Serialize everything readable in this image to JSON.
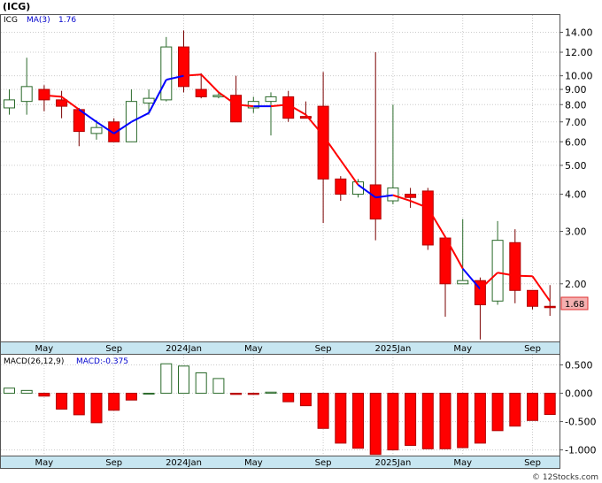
{
  "title": "(ICG)",
  "watermark": "© 12Stocks.com",
  "chart_data": [
    {
      "type": "candlestick",
      "ticker": "ICG",
      "ma_label": "MA(3)",
      "ma_value_text": "1.76",
      "last_price_text": "1.68",
      "y_scale": "log",
      "ylim": [
        1.28,
        16.0
      ],
      "y_ticks": [
        {
          "v": 14.0,
          "label": "14.00"
        },
        {
          "v": 12.0,
          "label": "12.00"
        },
        {
          "v": 10.0,
          "label": "10.00"
        },
        {
          "v": 9.0,
          "label": "9.00"
        },
        {
          "v": 8.0,
          "label": "8.00"
        },
        {
          "v": 7.0,
          "label": "7.00"
        },
        {
          "v": 6.0,
          "label": "6.00"
        },
        {
          "v": 5.0,
          "label": "5.00"
        },
        {
          "v": 4.0,
          "label": "4.00"
        },
        {
          "v": 3.0,
          "label": "3.00"
        },
        {
          "v": 2.0,
          "label": "2.00"
        }
      ],
      "x_ticks": [
        {
          "i": 2,
          "label": "May"
        },
        {
          "i": 6,
          "label": "Sep"
        },
        {
          "i": 10,
          "label": "2024Jan"
        },
        {
          "i": 14,
          "label": "May"
        },
        {
          "i": 18,
          "label": "Sep"
        },
        {
          "i": 22,
          "label": "2025Jan"
        },
        {
          "i": 26,
          "label": "May"
        },
        {
          "i": 30,
          "label": "Sep"
        }
      ],
      "candles": [
        {
          "o": 7.8,
          "h": 9.0,
          "l": 7.4,
          "c": 8.3
        },
        {
          "o": 8.2,
          "h": 11.5,
          "l": 7.4,
          "c": 9.2
        },
        {
          "o": 9.0,
          "h": 9.3,
          "l": 7.6,
          "c": 8.3
        },
        {
          "o": 8.3,
          "h": 8.9,
          "l": 7.2,
          "c": 7.9
        },
        {
          "o": 7.7,
          "h": 7.8,
          "l": 5.8,
          "c": 6.5
        },
        {
          "o": 6.4,
          "h": 7.1,
          "l": 6.1,
          "c": 6.7
        },
        {
          "o": 7.0,
          "h": 7.2,
          "l": 6.0,
          "c": 6.0
        },
        {
          "o": 6.0,
          "h": 9.0,
          "l": 6.0,
          "c": 8.2
        },
        {
          "o": 8.1,
          "h": 9.0,
          "l": 7.4,
          "c": 8.4
        },
        {
          "o": 8.3,
          "h": 13.5,
          "l": 8.2,
          "c": 12.5
        },
        {
          "o": 12.5,
          "h": 14.2,
          "l": 8.8,
          "c": 9.2
        },
        {
          "o": 9.0,
          "h": 10.2,
          "l": 8.4,
          "c": 8.5
        },
        {
          "o": 8.5,
          "h": 8.8,
          "l": 8.4,
          "c": 8.6
        },
        {
          "o": 8.6,
          "h": 10.0,
          "l": 7.0,
          "c": 7.0
        },
        {
          "o": 7.8,
          "h": 8.5,
          "l": 7.5,
          "c": 8.2
        },
        {
          "o": 8.2,
          "h": 8.8,
          "l": 6.3,
          "c": 8.5
        },
        {
          "o": 8.5,
          "h": 8.9,
          "l": 7.0,
          "c": 7.2
        },
        {
          "o": 7.3,
          "h": 8.2,
          "l": 7.2,
          "c": 7.2
        },
        {
          "o": 7.9,
          "h": 10.3,
          "l": 3.2,
          "c": 4.5
        },
        {
          "o": 4.5,
          "h": 4.6,
          "l": 3.8,
          "c": 4.0
        },
        {
          "o": 4.0,
          "h": 4.5,
          "l": 3.9,
          "c": 4.4
        },
        {
          "o": 4.3,
          "h": 12.0,
          "l": 2.8,
          "c": 3.3
        },
        {
          "o": 3.8,
          "h": 8.0,
          "l": 3.7,
          "c": 4.2
        },
        {
          "o": 4.0,
          "h": 4.2,
          "l": 3.6,
          "c": 3.9
        },
        {
          "o": 4.1,
          "h": 4.2,
          "l": 2.6,
          "c": 2.7
        },
        {
          "o": 2.85,
          "h": 2.9,
          "l": 1.55,
          "c": 2.0
        },
        {
          "o": 2.0,
          "h": 3.3,
          "l": 2.0,
          "c": 2.05
        },
        {
          "o": 2.05,
          "h": 2.1,
          "l": 1.3,
          "c": 1.7
        },
        {
          "o": 1.75,
          "h": 3.25,
          "l": 1.7,
          "c": 2.8
        },
        {
          "o": 2.75,
          "h": 3.05,
          "l": 1.72,
          "c": 1.9
        },
        {
          "o": 1.9,
          "h": 1.9,
          "l": 1.64,
          "c": 1.68
        },
        {
          "o": 1.68,
          "h": 1.98,
          "l": 1.56,
          "c": 1.67
        }
      ],
      "ma3": [
        null,
        null,
        8.6,
        8.5,
        7.7,
        7.0,
        6.4,
        7.0,
        7.5,
        9.7,
        10.0,
        10.1,
        8.8,
        8.0,
        7.9,
        7.9,
        8.0,
        7.4,
        6.3,
        5.2,
        4.3,
        3.9,
        3.97,
        3.8,
        3.6,
        2.87,
        2.25,
        1.92,
        2.18,
        2.13,
        2.12,
        1.75
      ],
      "ma3_up": [
        false,
        false,
        false,
        false,
        false,
        true,
        true,
        true,
        true,
        true,
        true,
        false,
        false,
        false,
        false,
        true,
        false,
        false,
        false,
        false,
        false,
        true,
        true,
        false,
        false,
        false,
        false,
        true,
        false,
        false,
        false,
        false
      ]
    },
    {
      "type": "bar",
      "label": "MACD(26,12,9)",
      "value_label": "MACD:-0.375",
      "ylim": [
        -1.1,
        0.68
      ],
      "y_ticks": [
        {
          "v": 0.5,
          "label": "0.500"
        },
        {
          "v": 0.0,
          "label": "0.000"
        },
        {
          "v": -0.5,
          "label": "-0.500"
        },
        {
          "v": -1.0,
          "label": "-1.000"
        }
      ],
      "x_ticks": [
        {
          "i": 2,
          "label": "May"
        },
        {
          "i": 6,
          "label": "Sep"
        },
        {
          "i": 10,
          "label": "2024Jan"
        },
        {
          "i": 14,
          "label": "May"
        },
        {
          "i": 18,
          "label": "Sep"
        },
        {
          "i": 22,
          "label": "2025Jan"
        },
        {
          "i": 26,
          "label": "May"
        },
        {
          "i": 30,
          "label": "Sep"
        }
      ],
      "values": [
        0.09,
        0.05,
        -0.05,
        -0.28,
        -0.38,
        -0.52,
        -0.3,
        -0.12,
        0.0,
        0.52,
        0.48,
        0.36,
        0.26,
        -0.02,
        -0.02,
        0.02,
        -0.15,
        -0.22,
        -0.62,
        -0.88,
        -0.97,
        -1.08,
        -1.0,
        -0.92,
        -0.98,
        -0.98,
        -0.96,
        -0.88,
        -0.66,
        -0.58,
        -0.48,
        -0.375
      ],
      "up": [
        true,
        true,
        false,
        false,
        false,
        false,
        false,
        false,
        true,
        true,
        true,
        true,
        true,
        false,
        false,
        true,
        false,
        false,
        false,
        false,
        false,
        false,
        false,
        false,
        false,
        false,
        false,
        false,
        false,
        false,
        false,
        false
      ]
    }
  ]
}
